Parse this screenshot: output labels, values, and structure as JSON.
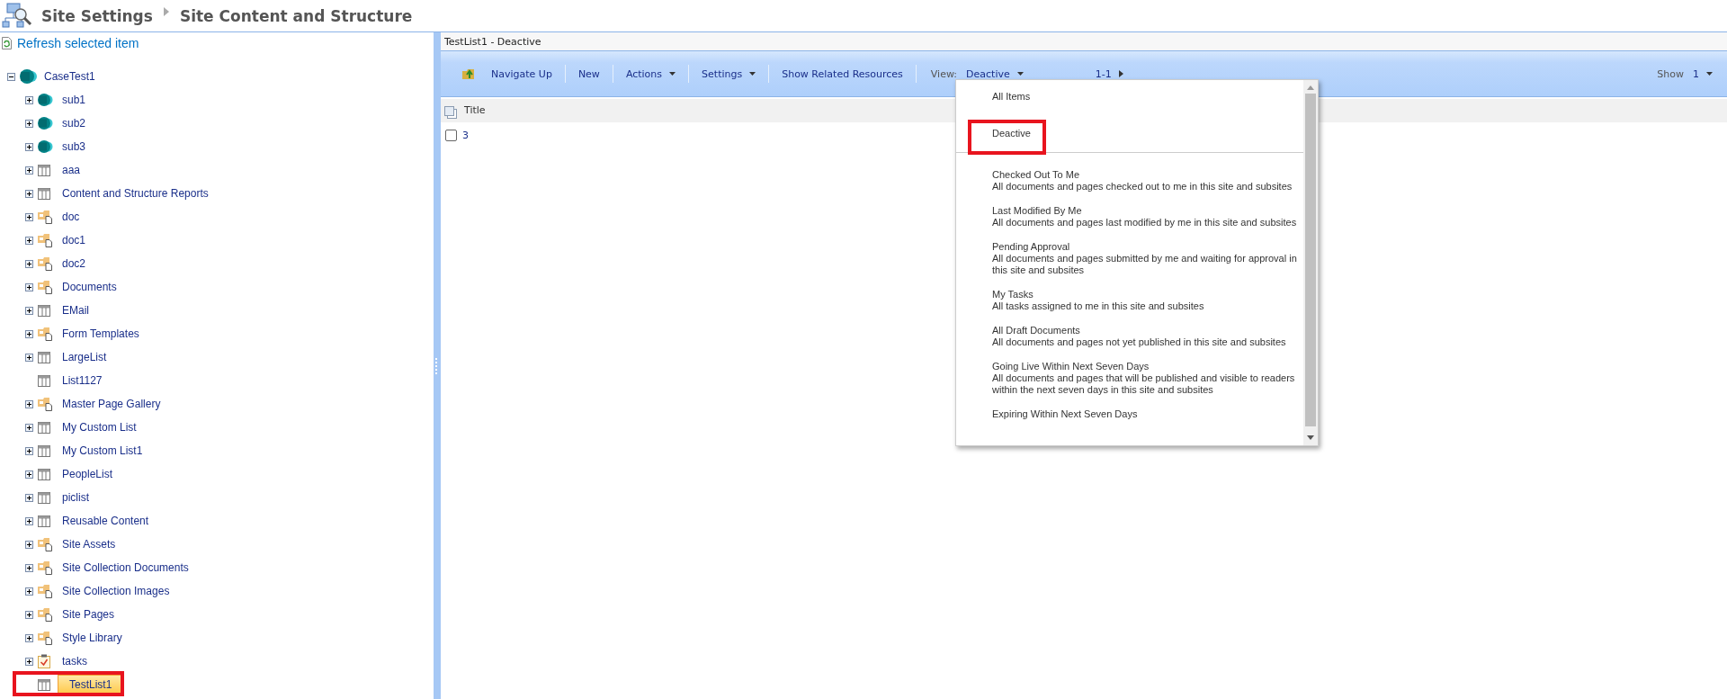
{
  "header": {
    "breadcrumb": [
      "Site Settings",
      "Site Content and Structure"
    ]
  },
  "sidebar": {
    "refresh_link": "Refresh selected item",
    "tree": [
      {
        "label": "CaseTest1",
        "kind": "site",
        "expanded": true,
        "selected": false,
        "annotated": false,
        "children": [
          {
            "label": "sub1",
            "kind": "site",
            "expanded": false,
            "selected": false,
            "annotated": false
          },
          {
            "label": "sub2",
            "kind": "site",
            "expanded": false,
            "selected": false,
            "annotated": false
          },
          {
            "label": "sub3",
            "kind": "site",
            "expanded": false,
            "selected": false,
            "annotated": false
          },
          {
            "label": "aaa",
            "kind": "list",
            "expanded": false,
            "selected": false,
            "annotated": false
          },
          {
            "label": "Content and Structure Reports",
            "kind": "list",
            "expanded": false,
            "selected": false,
            "annotated": false
          },
          {
            "label": "doc",
            "kind": "library",
            "expanded": false,
            "selected": false,
            "annotated": false
          },
          {
            "label": "doc1",
            "kind": "library",
            "expanded": false,
            "selected": false,
            "annotated": false
          },
          {
            "label": "doc2",
            "kind": "library",
            "expanded": false,
            "selected": false,
            "annotated": false
          },
          {
            "label": "Documents",
            "kind": "library",
            "expanded": false,
            "selected": false,
            "annotated": false
          },
          {
            "label": "EMail",
            "kind": "list",
            "expanded": false,
            "selected": false,
            "annotated": false
          },
          {
            "label": "Form Templates",
            "kind": "library",
            "expanded": false,
            "selected": false,
            "annotated": false
          },
          {
            "label": "LargeList",
            "kind": "list",
            "expanded": false,
            "selected": false,
            "annotated": false
          },
          {
            "label": "List1127",
            "kind": "list",
            "selected": false,
            "annotated": false
          },
          {
            "label": "Master Page Gallery",
            "kind": "library",
            "expanded": false,
            "selected": false,
            "annotated": false
          },
          {
            "label": "My Custom List",
            "kind": "list",
            "expanded": false,
            "selected": false,
            "annotated": false
          },
          {
            "label": "My Custom List1",
            "kind": "list",
            "expanded": false,
            "selected": false,
            "annotated": false
          },
          {
            "label": "PeopleList",
            "kind": "list",
            "expanded": false,
            "selected": false,
            "annotated": false
          },
          {
            "label": "piclist",
            "kind": "list",
            "expanded": false,
            "selected": false,
            "annotated": false
          },
          {
            "label": "Reusable Content",
            "kind": "list",
            "expanded": false,
            "selected": false,
            "annotated": false
          },
          {
            "label": "Site Assets",
            "kind": "library",
            "expanded": false,
            "selected": false,
            "annotated": false
          },
          {
            "label": "Site Collection Documents",
            "kind": "library",
            "expanded": false,
            "selected": false,
            "annotated": false
          },
          {
            "label": "Site Collection Images",
            "kind": "library",
            "expanded": false,
            "selected": false,
            "annotated": false
          },
          {
            "label": "Site Pages",
            "kind": "library",
            "expanded": false,
            "selected": false,
            "annotated": false
          },
          {
            "label": "Style Library",
            "kind": "library",
            "expanded": false,
            "selected": false,
            "annotated": false
          },
          {
            "label": "tasks",
            "kind": "tasks",
            "expanded": false,
            "selected": false,
            "annotated": false
          },
          {
            "label": "TestList1",
            "kind": "list",
            "selected": true,
            "annotated": true
          }
        ]
      }
    ]
  },
  "main": {
    "title": "TestList1 - Deactive",
    "toolbar": {
      "buttons": [
        {
          "label": "Navigate Up",
          "kind": "navigate"
        },
        {
          "label": "New",
          "kind": "plain"
        },
        {
          "label": "Actions",
          "kind": "menu"
        },
        {
          "label": "Settings",
          "kind": "menu"
        },
        {
          "label": "Show Related Resources",
          "kind": "plain"
        }
      ],
      "view_label": "View:",
      "view_value": "Deactive",
      "paging": "1-1",
      "show_label": "Show",
      "show_value": "1"
    },
    "table": {
      "columns": [
        "Title"
      ],
      "rows": [
        {
          "checked": false,
          "title": "3"
        }
      ]
    },
    "view_menu": {
      "items": [
        {
          "title": "All Items",
          "selected": false,
          "annotated": false
        },
        {
          "title": "Deactive",
          "selected": true,
          "annotated": true
        },
        {
          "kind": "divider"
        },
        {
          "title": "Checked Out To Me",
          "description": "All documents and pages checked out to me in this site and subsites",
          "selected": false,
          "annotated": false
        },
        {
          "title": "Last Modified By Me",
          "description": "All documents and pages last modified by me in this site and subsites",
          "selected": false,
          "annotated": false
        },
        {
          "title": "Pending Approval",
          "description": "All documents and pages submitted by me and waiting for approval in this site and subsites",
          "selected": false,
          "annotated": false
        },
        {
          "title": "My Tasks",
          "description": "All tasks assigned to me in this site and subsites",
          "selected": false,
          "annotated": false
        },
        {
          "title": "All Draft Documents",
          "description": "All documents and pages not yet published in this site and subsites",
          "selected": false,
          "annotated": false
        },
        {
          "title": "Going Live Within Next Seven Days",
          "description": "All documents and pages that will be published and visible to readers within the next seven days in this site and subsites",
          "selected": false,
          "annotated": false
        },
        {
          "title": "Expiring Within Next Seven Days",
          "selected": false,
          "annotated": false
        }
      ]
    }
  }
}
